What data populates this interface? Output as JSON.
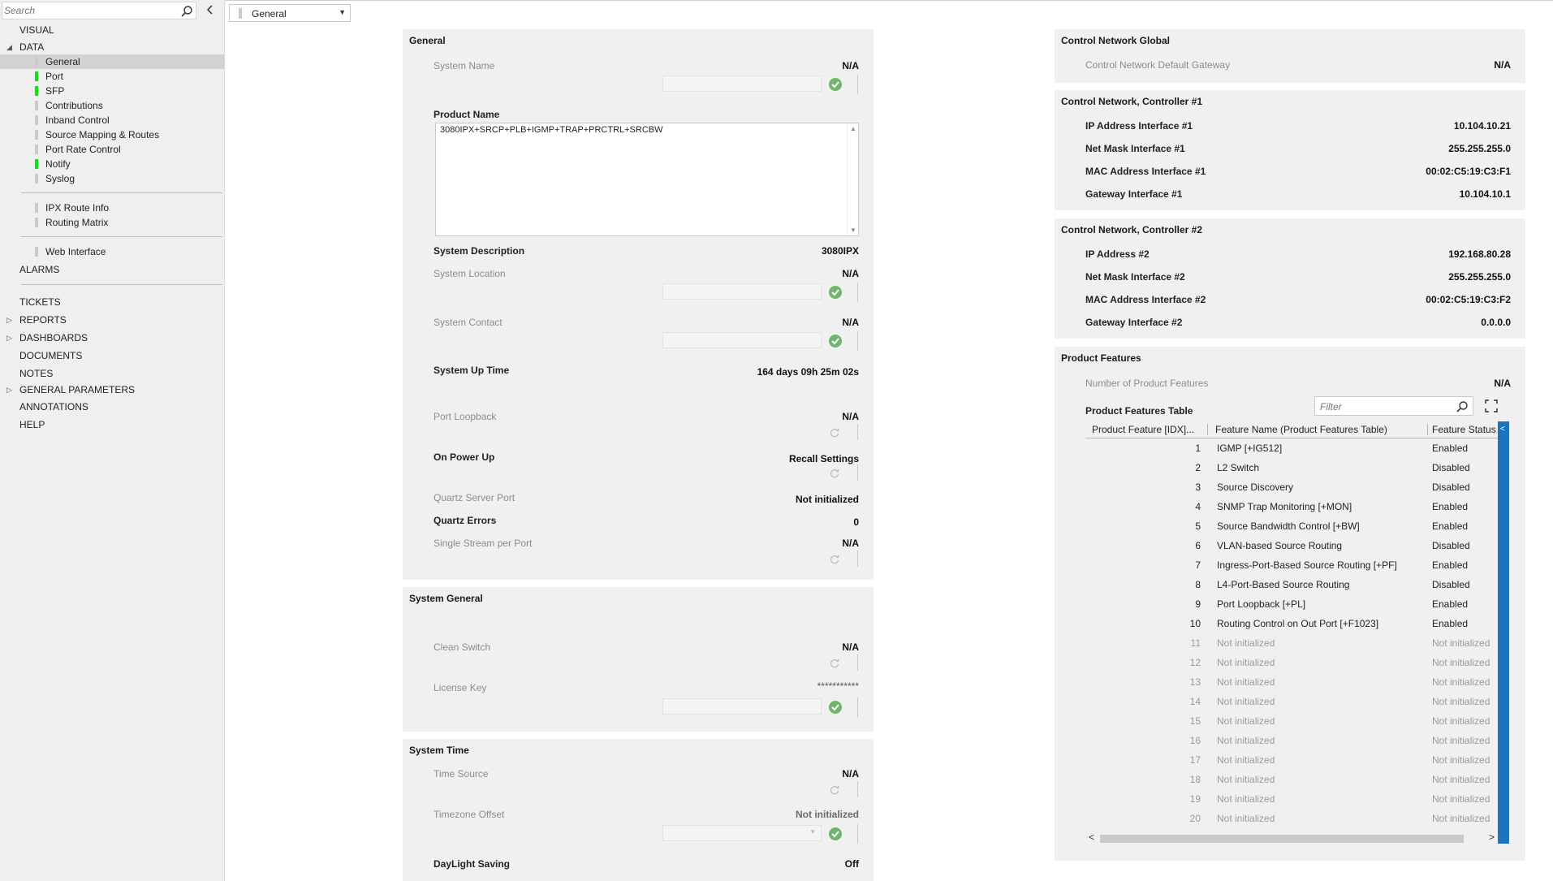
{
  "search": {
    "placeholder": "Search"
  },
  "nav": {
    "visual": "VISUAL",
    "data": "DATA",
    "data_items": [
      "General",
      "Port",
      "SFP",
      "Contributions",
      "Inband Control",
      "Source Mapping & Routes",
      "Port Rate Control",
      "Notify",
      "Syslog"
    ],
    "ipx_items": [
      "IPX Route Info",
      "Routing Matrix"
    ],
    "web_items": [
      "Web Interface"
    ],
    "alarms": "ALARMS",
    "tickets": "TICKETS",
    "reports": "REPORTS",
    "dashboards": "DASHBOARDS",
    "documents": "DOCUMENTS",
    "notes": "NOTES",
    "general_parameters": "GENERAL PARAMETERS",
    "annotations": "ANNOTATIONS",
    "help": "HELP"
  },
  "page_select": {
    "value": "General"
  },
  "general": {
    "title": "General",
    "system_name_label": "System Name",
    "system_name_value": "N/A",
    "product_name_label": "Product Name",
    "product_name_value": "3080IPX+SRCP+PLB+IGMP+TRAP+PRCTRL+SRCBW",
    "system_description_label": "System Description",
    "system_description_value": "3080IPX",
    "system_location_label": "System Location",
    "system_location_value": "N/A",
    "system_contact_label": "System Contact",
    "system_contact_value": "N/A",
    "system_uptime_label": "System Up Time",
    "system_uptime_value": "164 days 09h 25m 02s",
    "port_loopback_label": "Port Loopback",
    "port_loopback_value": "N/A",
    "on_power_up_label": "On Power Up",
    "on_power_up_value": "Recall Settings",
    "quartz_server_port_label": "Quartz Server Port",
    "quartz_server_port_value": "Not initialized",
    "quartz_errors_label": "Quartz Errors",
    "quartz_errors_value": "0",
    "single_stream_label": "Single Stream per Port",
    "single_stream_value": "N/A"
  },
  "system_general": {
    "title": "System General",
    "clean_switch_label": "Clean Switch",
    "clean_switch_value": "N/A",
    "license_key_label": "License Key",
    "license_key_value": "***********"
  },
  "system_time": {
    "title": "System Time",
    "time_source_label": "Time Source",
    "time_source_value": "N/A",
    "timezone_offset_label": "Timezone Offset",
    "timezone_offset_value": "Not initialized",
    "daylight_saving_label": "DayLight Saving",
    "daylight_saving_value": "Off"
  },
  "cn_global": {
    "title": "Control Network Global",
    "gateway_label": "Control Network Default Gateway",
    "gateway_value": "N/A"
  },
  "cn_controller1": {
    "title": "Control Network, Controller #1",
    "ip_label": "IP Address Interface #1",
    "ip_value": "10.104.10.21",
    "mask_label": "Net Mask Interface #1",
    "mask_value": "255.255.255.0",
    "mac_label": "MAC Address Interface #1",
    "mac_value": "00:02:C5:19:C3:F1",
    "gw_label": "Gateway Interface #1",
    "gw_value": "10.104.10.1"
  },
  "cn_controller2": {
    "title": "Control Network, Controller #2",
    "ip_label": "IP Address #2",
    "ip_value": "192.168.80.28",
    "mask_label": "Net Mask Interface #2",
    "mask_value": "255.255.255.0",
    "mac_label": "MAC Address Interface #2",
    "mac_value": "00:02:C5:19:C3:F2",
    "gw_label": "Gateway Interface #2",
    "gw_value": "0.0.0.0"
  },
  "product_features": {
    "title": "Product Features",
    "count_label": "Number of Product Features",
    "count_value": "N/A",
    "table_label": "Product Features Table",
    "filter_placeholder": "Filter",
    "columns": [
      "Product Feature [IDX]...",
      "Feature Name (Product Features Table)",
      "Feature Status..."
    ],
    "rows": [
      [
        "1",
        "IGMP [+IG512]",
        "Enabled"
      ],
      [
        "2",
        "L2 Switch",
        "Disabled"
      ],
      [
        "3",
        "Source Discovery",
        "Disabled"
      ],
      [
        "4",
        "SNMP Trap Monitoring [+MON]",
        "Enabled"
      ],
      [
        "5",
        "Source Bandwidth Control [+BW]",
        "Enabled"
      ],
      [
        "6",
        "VLAN-based Source Routing",
        "Disabled"
      ],
      [
        "7",
        "Ingress-Port-Based Source Routing [+PF]",
        "Enabled"
      ],
      [
        "8",
        "L4-Port-Based Source Routing",
        "Disabled"
      ],
      [
        "9",
        "Port Loopback [+PL]",
        "Enabled"
      ],
      [
        "10",
        "Routing Control on Out Port [+F1023]",
        "Enabled"
      ],
      [
        "11",
        "Not initialized",
        "Not initialized"
      ],
      [
        "12",
        "Not initialized",
        "Not initialized"
      ],
      [
        "13",
        "Not initialized",
        "Not initialized"
      ],
      [
        "14",
        "Not initialized",
        "Not initialized"
      ],
      [
        "15",
        "Not initialized",
        "Not initialized"
      ],
      [
        "16",
        "Not initialized",
        "Not initialized"
      ],
      [
        "17",
        "Not initialized",
        "Not initialized"
      ],
      [
        "18",
        "Not initialized",
        "Not initialized"
      ],
      [
        "19",
        "Not initialized",
        "Not initialized"
      ],
      [
        "20",
        "Not initialized",
        "Not initialized"
      ]
    ]
  },
  "colors": {
    "accent": "#1e73be",
    "status_ok": "#11e011",
    "check": "#6fb56f"
  }
}
